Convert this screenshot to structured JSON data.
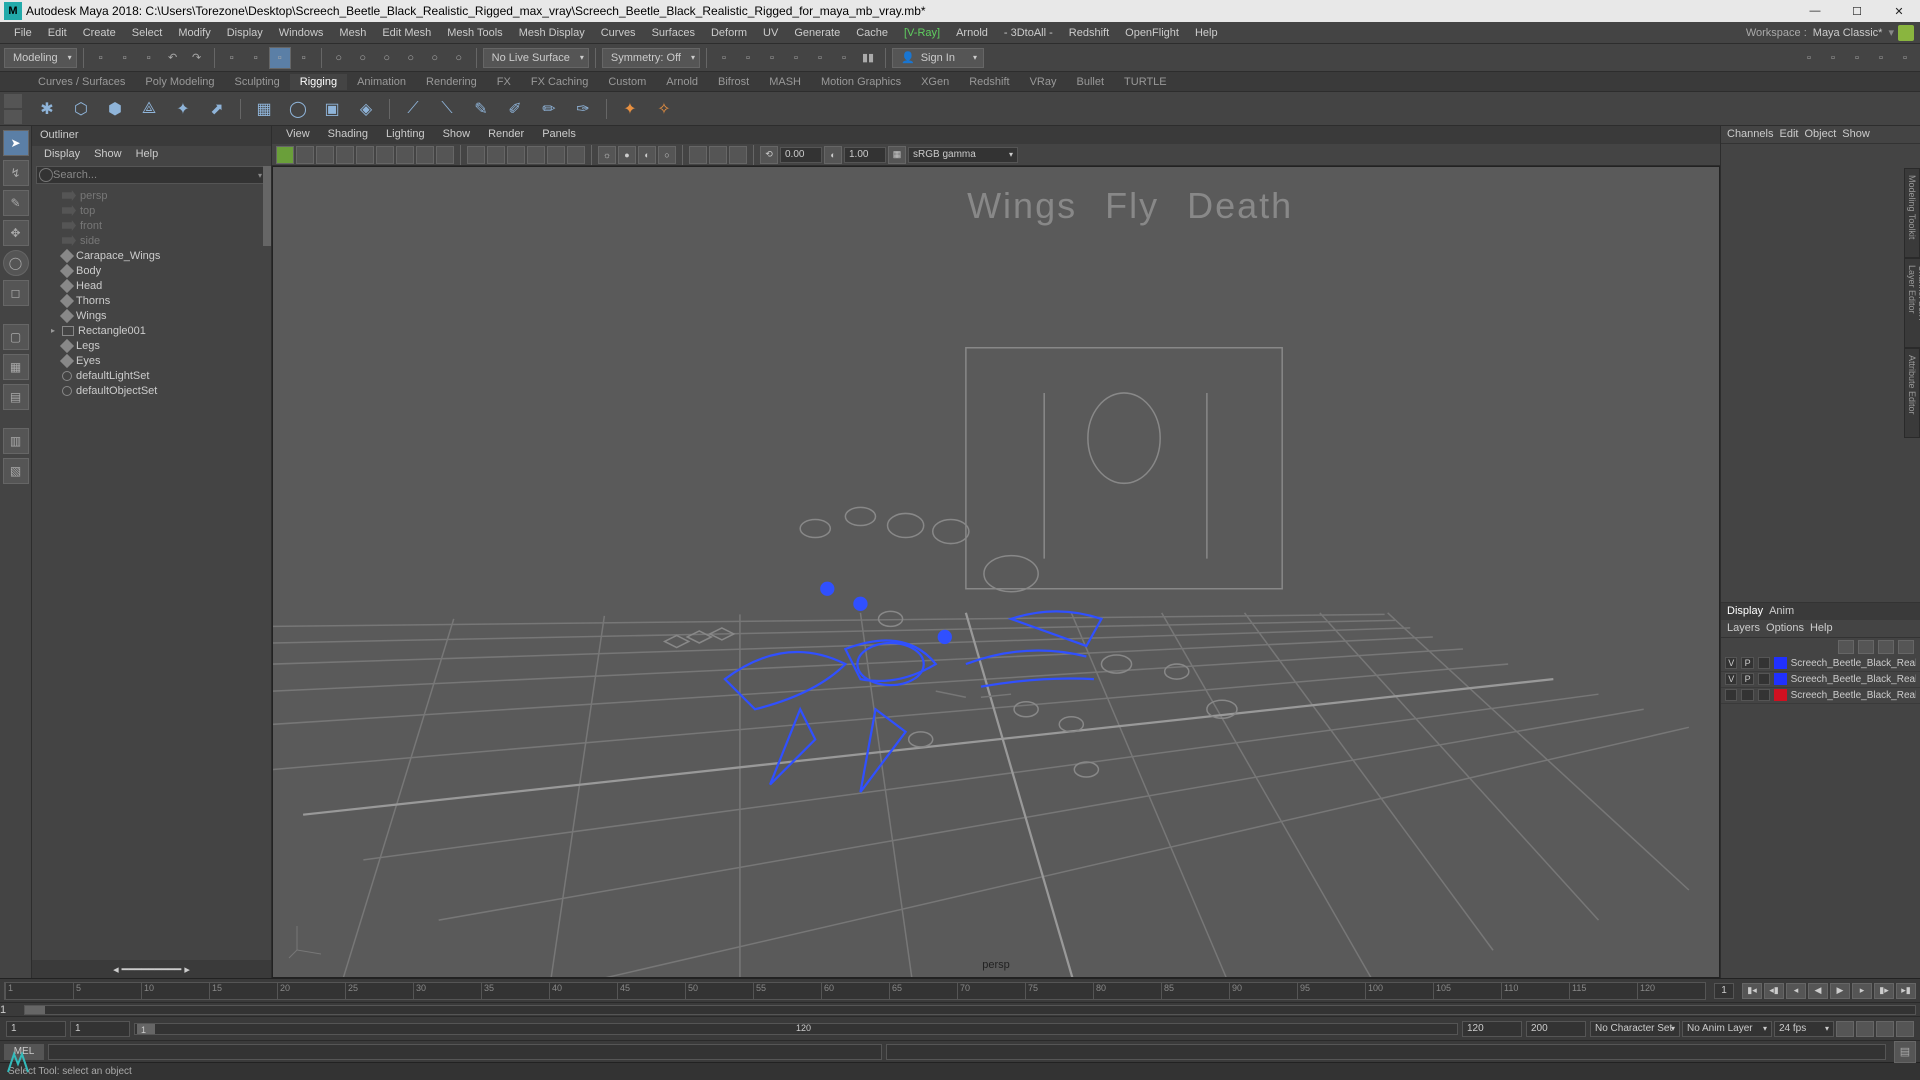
{
  "title": "Autodesk Maya 2018: C:\\Users\\Torezone\\Desktop\\Screech_Beetle_Black_Realistic_Rigged_max_vray\\Screech_Beetle_Black_Realistic_Rigged_for_maya_mb_vray.mb*",
  "menubar": [
    "File",
    "Edit",
    "Create",
    "Select",
    "Modify",
    "Display",
    "Windows",
    "Mesh",
    "Edit Mesh",
    "Mesh Tools",
    "Mesh Display",
    "Curves",
    "Surfaces",
    "Deform",
    "UV",
    "Generate",
    "Cache",
    "[V-Ray]",
    "Arnold",
    "- 3DtoAll -",
    "Redshift",
    "OpenFlight",
    "Help"
  ],
  "workspace_label": "Workspace :",
  "workspace_value": "Maya Classic*",
  "mode": "Modeling",
  "live_surface": "No Live Surface",
  "symmetry": "Symmetry: Off",
  "signin": "Sign In",
  "shelf_tabs": [
    "Curves / Surfaces",
    "Poly Modeling",
    "Sculpting",
    "Rigging",
    "Animation",
    "Rendering",
    "FX",
    "FX Caching",
    "Custom",
    "Arnold",
    "Bifrost",
    "MASH",
    "Motion Graphics",
    "XGen",
    "Redshift",
    "VRay",
    "Bullet",
    "TURTLE"
  ],
  "shelf_active": "Rigging",
  "outliner": {
    "title": "Outliner",
    "menu": [
      "Display",
      "Show",
      "Help"
    ],
    "search_placeholder": "Search...",
    "items": [
      {
        "label": "persp",
        "type": "cam",
        "dim": true
      },
      {
        "label": "top",
        "type": "cam",
        "dim": true
      },
      {
        "label": "front",
        "type": "cam",
        "dim": true
      },
      {
        "label": "side",
        "type": "cam",
        "dim": true
      },
      {
        "label": "Carapace_Wings",
        "type": "mesh"
      },
      {
        "label": "Body",
        "type": "mesh"
      },
      {
        "label": "Head",
        "type": "mesh"
      },
      {
        "label": "Thorns",
        "type": "mesh"
      },
      {
        "label": "Wings",
        "type": "mesh"
      },
      {
        "label": "Rectangle001",
        "type": "grp",
        "exp": true
      },
      {
        "label": "Legs",
        "type": "mesh"
      },
      {
        "label": "Eyes",
        "type": "mesh"
      },
      {
        "label": "defaultLightSet",
        "type": "set"
      },
      {
        "label": "defaultObjectSet",
        "type": "set"
      }
    ]
  },
  "viewport": {
    "menu": [
      "View",
      "Shading",
      "Lighting",
      "Show",
      "Render",
      "Panels"
    ],
    "val1": "0.00",
    "val2": "1.00",
    "gamma": "sRGB gamma",
    "label": "persp",
    "overlay": [
      "Wings",
      "Fly",
      "Death"
    ]
  },
  "channels": {
    "menu": [
      "Channels",
      "Edit",
      "Object",
      "Show"
    ]
  },
  "layers": {
    "tabs": [
      "Display",
      "Anim"
    ],
    "menu": [
      "Layers",
      "Options",
      "Help"
    ],
    "rows": [
      {
        "v": "V",
        "p": "P",
        "color": "#2030ff",
        "name": "Screech_Beetle_Black_Realistic"
      },
      {
        "v": "V",
        "p": "P",
        "color": "#2030ff",
        "name": "Screech_Beetle_Black_Realistic"
      },
      {
        "v": "",
        "p": "",
        "color": "#d01020",
        "name": "Screech_Beetle_Black_Realistic"
      }
    ]
  },
  "timeline": {
    "ticks": [
      "1",
      "5",
      "10",
      "15",
      "20",
      "25",
      "30",
      "35",
      "40",
      "45",
      "50",
      "55",
      "60",
      "65",
      "70",
      "75",
      "80",
      "85",
      "90",
      "95",
      "100",
      "105",
      "110",
      "115",
      "120"
    ],
    "cur": "1",
    "start": "1",
    "end": "120",
    "rstart": "1",
    "rend": "120",
    "inner_start": "1",
    "inner_end": "120",
    "outer_end": "200",
    "char": "No Character Set",
    "anim": "No Anim Layer",
    "fps": "24 fps"
  },
  "cmd_lang": "MEL",
  "help_text": "Select Tool: select an object"
}
